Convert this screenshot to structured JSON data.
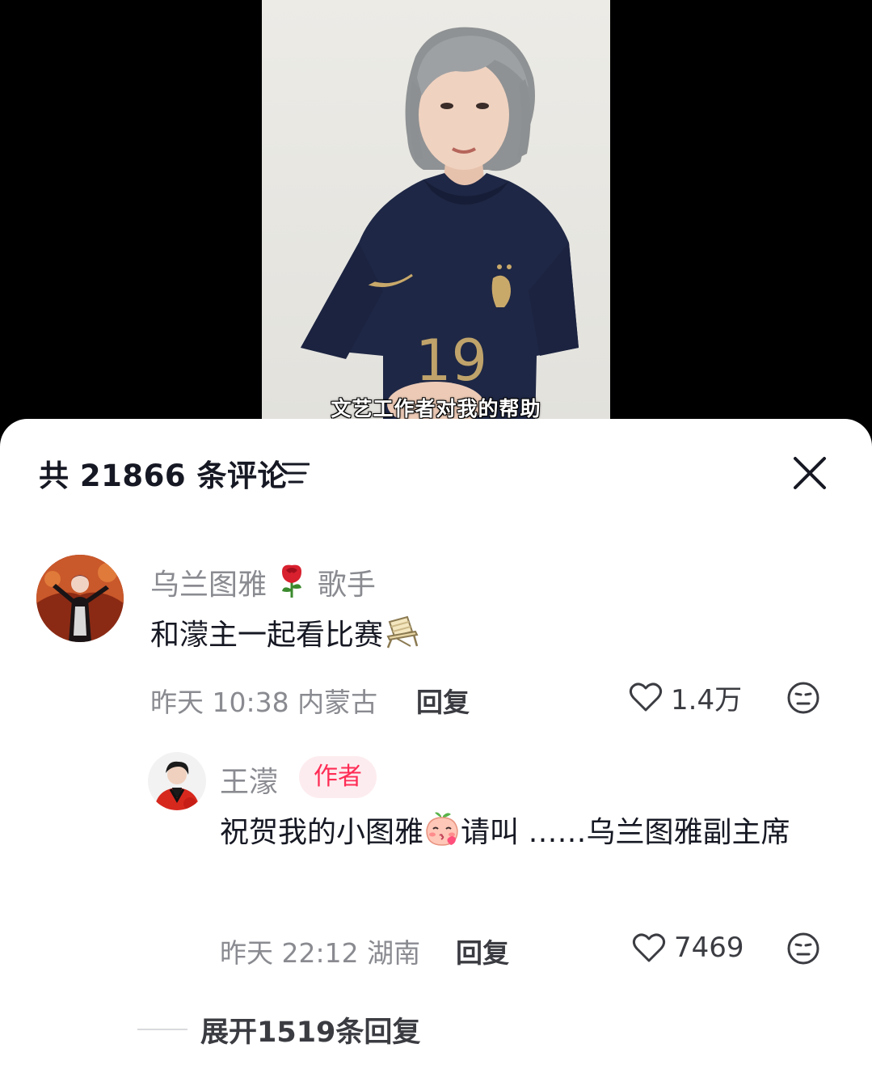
{
  "video": {
    "subtitle": "文艺工作者对我的帮助",
    "jersey_number": "19"
  },
  "comments_panel": {
    "count_label": "共 21866 条评论",
    "sort_icon": "sort-lines-icon",
    "close_icon": "close-icon"
  },
  "comments": [
    {
      "username": "乌兰图雅",
      "username_emoji": "rose-icon",
      "username_suffix": "歌手",
      "text": "和濛主一起看比赛",
      "text_emoji": "folding-chair-icon",
      "time": "昨天 10:38",
      "location": "内蒙古",
      "reply_label": "回复",
      "likes": "1.4万",
      "like_icon": "heart-outline-icon",
      "dislike_icon": "dislike-face-icon"
    }
  ],
  "replies": [
    {
      "username": "王濛",
      "badge": "作者",
      "text_part1": "祝贺我的小图雅",
      "text_emoji": "peach-kiss-icon",
      "text_part2": "请叫 ……乌兰图雅副主席",
      "time": "昨天 22:12",
      "location": "湖南",
      "reply_label": "回复",
      "likes": "7469",
      "like_icon": "heart-outline-icon",
      "dislike_icon": "dislike-face-icon"
    }
  ],
  "expand": {
    "label": "展开1519条回复"
  },
  "colors": {
    "accent_red": "#fe2c55",
    "badge_bg": "#fdecef",
    "primary_text": "#161823",
    "secondary_text": "#8a8b91"
  }
}
